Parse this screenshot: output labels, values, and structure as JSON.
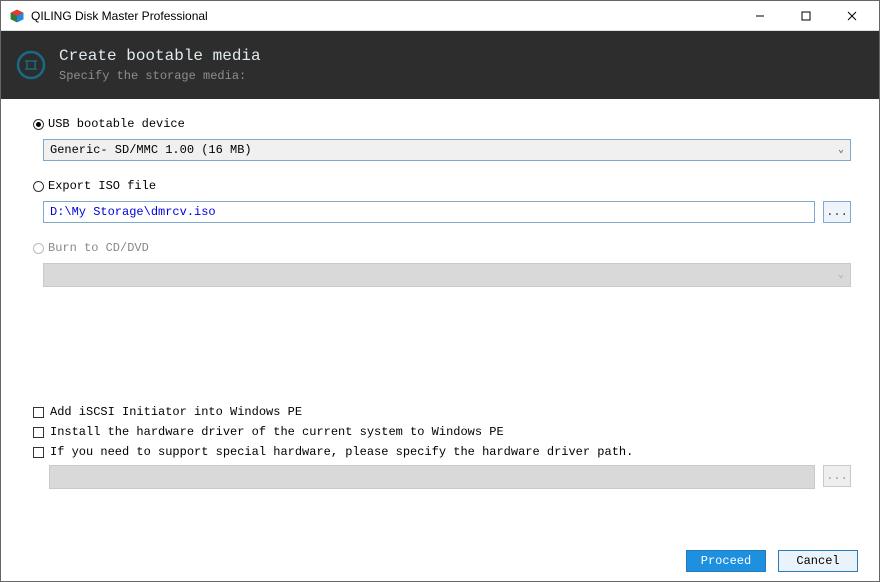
{
  "window": {
    "title": "QILING Disk Master Professional"
  },
  "header": {
    "title": "Create bootable media",
    "subtitle": "Specify the storage media:"
  },
  "options": {
    "usb": {
      "label": "USB bootable device",
      "selected": true,
      "value": "Generic- SD/MMC 1.00 (16 MB)"
    },
    "iso": {
      "label": "Export ISO file",
      "selected": false,
      "path": "D:\\My Storage\\dmrcv.iso",
      "browse": "..."
    },
    "cd": {
      "label": "Burn to CD/DVD",
      "disabled": true
    }
  },
  "checks": {
    "iscsi": {
      "label": "Add iSCSI Initiator into Windows PE"
    },
    "driver_current": {
      "label": "Install the hardware driver of the current system to Windows PE"
    },
    "driver_path": {
      "label": "If you need to support special hardware, please specify the hardware driver path.",
      "browse": "..."
    }
  },
  "footer": {
    "proceed": "Proceed",
    "cancel": "Cancel"
  }
}
